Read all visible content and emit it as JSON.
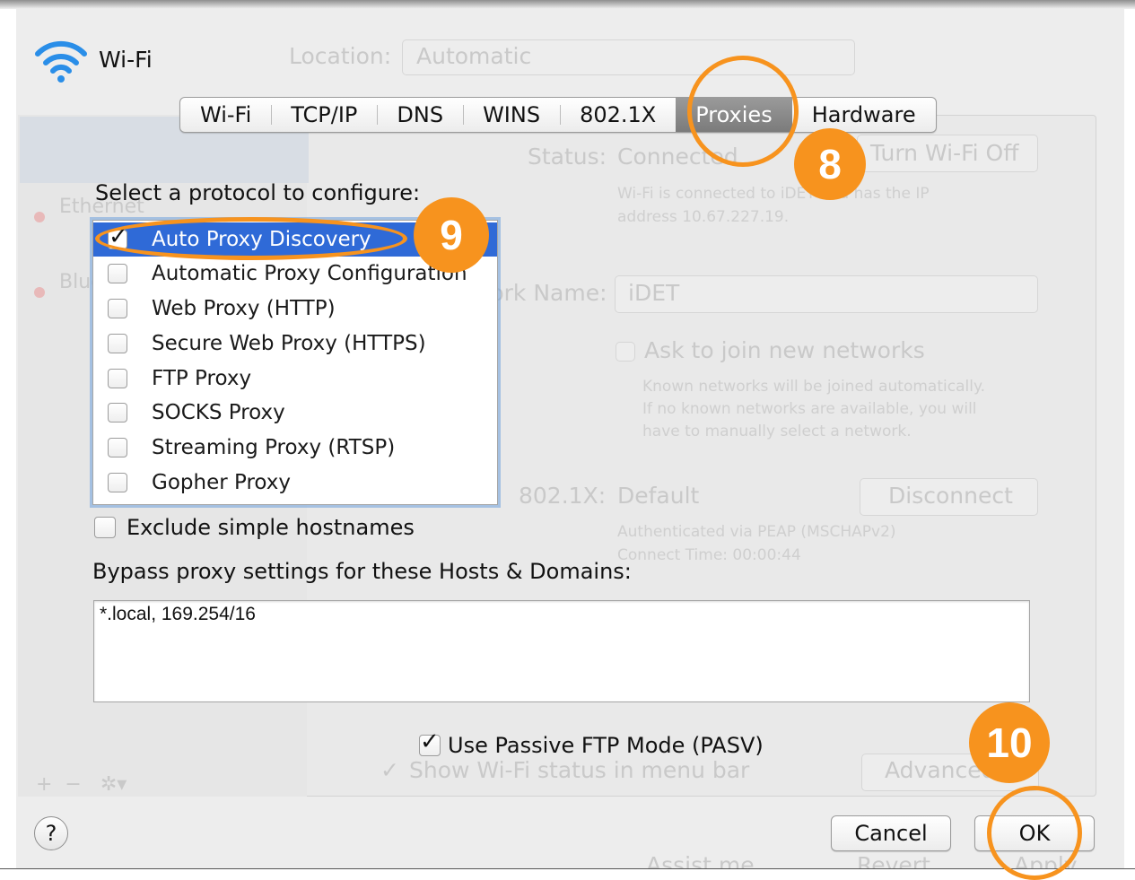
{
  "window": {
    "title": "Wi-Fi"
  },
  "background": {
    "location_label": "Location:",
    "location_value": "Automatic",
    "sidebar_items": [
      "Ethernet",
      "Bluetooth"
    ],
    "status_label": "Status:",
    "status_value": "Connected",
    "turn_off_button": "Turn Wi-Fi Off",
    "status_desc_1": "Wi-Fi is connected to iDET and has the IP",
    "status_desc_2": "address 10.67.227.19.",
    "network_label": "Network Name:",
    "network_value": "iDET",
    "ask_join": "Ask to join new networks",
    "ask_desc_1": "Known networks will be joined automatically.",
    "ask_desc_2": "If no known networks are available, you will",
    "ask_desc_3": "have to manually select a network.",
    "dot1x_label": "802.1X:",
    "dot1x_value": "Default",
    "disconnect_button": "Disconnect",
    "auth_line": "Authenticated via PEAP (MSCHAPv2)",
    "connect_time": "Connect Time: 00:00:44",
    "show_status": "Show Wi-Fi status in menu bar",
    "advanced_button": "Advanced...",
    "assist_button": "Assist me...",
    "revert_button": "Revert",
    "apply_button": "Apply"
  },
  "tabs": [
    {
      "label": "Wi-Fi"
    },
    {
      "label": "TCP/IP"
    },
    {
      "label": "DNS"
    },
    {
      "label": "WINS"
    },
    {
      "label": "802.1X"
    },
    {
      "label": "Proxies",
      "active": true
    },
    {
      "label": "Hardware"
    }
  ],
  "proxies": {
    "select_label": "Select a protocol to configure:",
    "protocols": [
      {
        "label": "Auto Proxy Discovery",
        "checked": true,
        "selected": true
      },
      {
        "label": "Automatic Proxy Configuration",
        "checked": false
      },
      {
        "label": "Web Proxy (HTTP)",
        "checked": false
      },
      {
        "label": "Secure Web Proxy (HTTPS)",
        "checked": false
      },
      {
        "label": "FTP Proxy",
        "checked": false
      },
      {
        "label": "SOCKS Proxy",
        "checked": false
      },
      {
        "label": "Streaming Proxy (RTSP)",
        "checked": false
      },
      {
        "label": "Gopher Proxy",
        "checked": false
      }
    ],
    "exclude_label": "Exclude simple hostnames",
    "exclude_checked": false,
    "bypass_label": "Bypass proxy settings for these Hosts & Domains:",
    "bypass_value": "*.local, 169.254/16",
    "pasv_label": "Use Passive FTP Mode (PASV)",
    "pasv_checked": true
  },
  "footer": {
    "help": "?",
    "cancel_button": "Cancel",
    "ok_button": "OK"
  },
  "annotations": {
    "accent_color": "#f7931e",
    "step_8": "8",
    "step_9": "9",
    "step_10": "10"
  }
}
